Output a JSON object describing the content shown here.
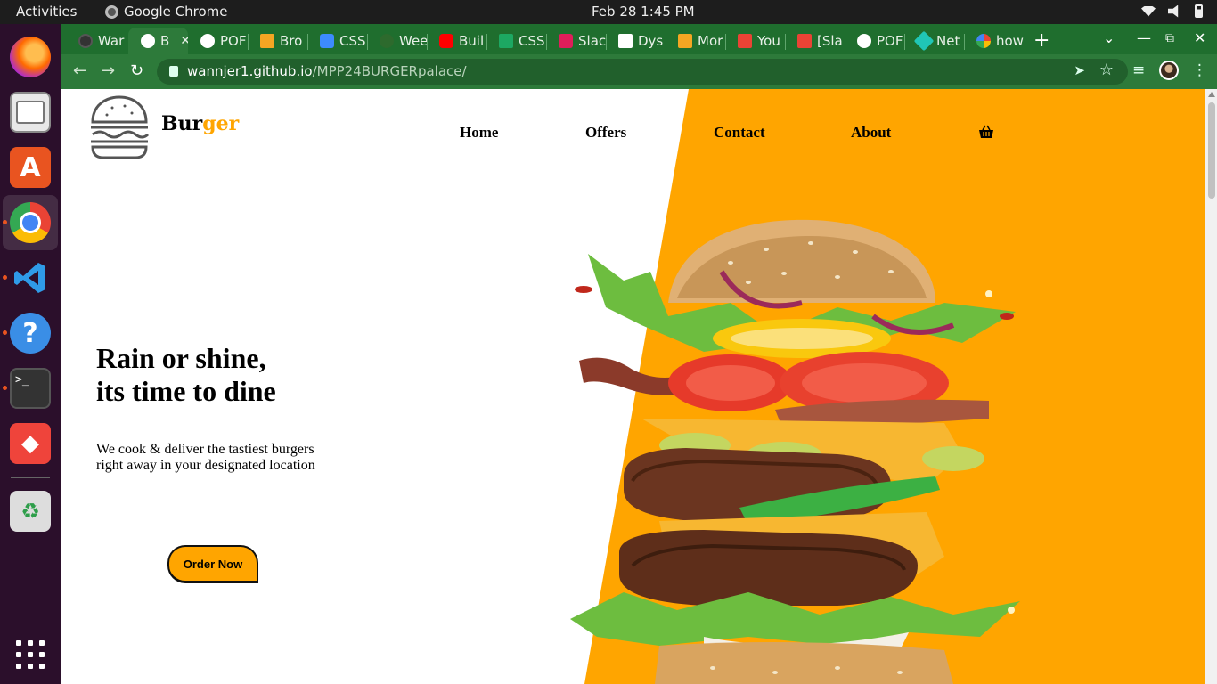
{
  "system": {
    "activities": "Activities",
    "app_name": "Google Chrome",
    "clock": "Feb 28  1:45 PM"
  },
  "tabs": [
    {
      "label": "War",
      "favicon_color": "#333333"
    },
    {
      "label": "B",
      "favicon_color": "#ffffff",
      "active": true
    },
    {
      "label": "POF",
      "favicon_color": "#ffffff"
    },
    {
      "label": "Bro",
      "favicon_color": "#f5a623"
    },
    {
      "label": "CSS",
      "favicon_color": "#3d8bfd"
    },
    {
      "label": "Wee",
      "favicon_color": "#2d6a2d"
    },
    {
      "label": "Buil",
      "favicon_color": "#ff0000"
    },
    {
      "label": "CSS",
      "favicon_color": "#1da862"
    },
    {
      "label": "Slac",
      "favicon_color": "#e01e5a"
    },
    {
      "label": "Dys",
      "favicon_color": "#ffffff"
    },
    {
      "label": "Mor",
      "favicon_color": "#f5a623"
    },
    {
      "label": "You",
      "favicon_color": "#ea4335"
    },
    {
      "label": "[Sla",
      "favicon_color": "#ea4335"
    },
    {
      "label": "POF",
      "favicon_color": "#ffffff"
    },
    {
      "label": "Net",
      "favicon_color": "#20c6b6"
    },
    {
      "label": "how",
      "favicon_color": "#4285f4"
    }
  ],
  "address": {
    "host": "wannjer1.github.io",
    "path": "/MPP24BURGERpalace/"
  },
  "page": {
    "brand_main": "Bur",
    "brand_accent": "ger",
    "nav": [
      "Home",
      "Offers",
      "Contact",
      "About"
    ],
    "hero_line1": "Rain or shine,",
    "hero_line2": "its time to dine",
    "sub_line1": "We cook & deliver the tastiest burgers",
    "sub_line2": "right away in your designated location",
    "cta": "Order Now"
  },
  "colors": {
    "accent": "#ffa500",
    "chrome_tabbar": "#1f6e2e",
    "chrome_toolbar": "#2d7a3a",
    "dock": "#2b0f2b"
  }
}
